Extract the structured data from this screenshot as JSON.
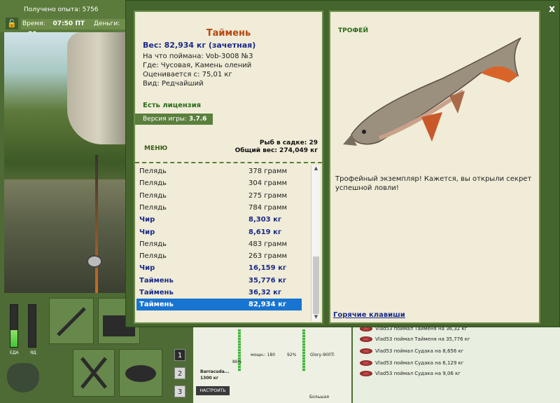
{
  "hud": {
    "experience_label": "Получено опыта: 5756",
    "time_label": "Время:",
    "time_value": "07:50 ПТ",
    "money_label": "Деньги:",
    "money_value": "30"
  },
  "meters": {
    "food_label": "ЕДА",
    "food_level": 0.4,
    "poison_label": "ЯД",
    "poison_level": 0.0
  },
  "slots": [
    "1",
    "2",
    "3"
  ],
  "tackle": {
    "rod_name": "Barracuda...",
    "rod_test": "1300 кг",
    "rod_condition": "86%",
    "reel_power": "мощн.: 180",
    "reel_condition": "92%",
    "line_name": "Glory-900Ti",
    "lure_size": "Большая",
    "adjust_button": "НАСТРОИТЬ"
  },
  "chat": [
    "Vlad53 поймал Тайменя на 36,32 кг",
    "Vlad53 поймал Тайменя на 35,776 кг",
    "Vlad53 поймал Судака на 8,656 кг",
    "Vlad53 поймал Судака на 6,129 кг",
    "Vlad53 поймал Судака на 9,06 кг"
  ],
  "modal": {
    "close": "x",
    "fish_name": "Таймень",
    "weight": "Вес: 82,934 кг (зачетная)",
    "caught_on": "На что поймана: Vob-3008 №3",
    "location": "Где: Чусовая, Камень олений",
    "value": "Оценивается с: 75,01 кг",
    "rarity": "Вид: Редчайший",
    "license": "Есть лицензия",
    "version_label": "Версия игры:",
    "version_value": "3.7.6",
    "menu": "МЕНЮ",
    "keepnet_count": "Рыб в садке: 29",
    "keepnet_weight": "Общий вес: 274,049 кг",
    "catches": [
      {
        "name": "Пелядь",
        "weight": "378 грамм",
        "style": "normal"
      },
      {
        "name": "Пелядь",
        "weight": "304 грамм",
        "style": "normal"
      },
      {
        "name": "Пелядь",
        "weight": "275 грамм",
        "style": "normal"
      },
      {
        "name": "Пелядь",
        "weight": "784 грамм",
        "style": "normal"
      },
      {
        "name": "Чир",
        "weight": "8,303 кг",
        "style": "bold"
      },
      {
        "name": "Чир",
        "weight": "8,619 кг",
        "style": "bold"
      },
      {
        "name": "Пелядь",
        "weight": "483 грамм",
        "style": "normal"
      },
      {
        "name": "Пелядь",
        "weight": "263 грамм",
        "style": "normal"
      },
      {
        "name": "Чир",
        "weight": "16,159 кг",
        "style": "bold"
      },
      {
        "name": "Таймень",
        "weight": "35,776 кг",
        "style": "bold"
      },
      {
        "name": "Таймень",
        "weight": "36,32 кг",
        "style": "bold"
      },
      {
        "name": "Таймень",
        "weight": "82,934 кг",
        "style": "selected"
      }
    ],
    "trophy_title": "ТРОФЕЙ",
    "trophy_text": "Трофейный экземпляр! Кажется, вы открыли секрет успешной ловли!",
    "hotkeys": "Горячие клавиши"
  },
  "colors": {
    "frame_green": "#44652c",
    "card_bg": "#f0ecd7",
    "selected_row": "#1874d1",
    "fish_name": "#b8460e",
    "bold_blue": "#1a2a8a"
  }
}
